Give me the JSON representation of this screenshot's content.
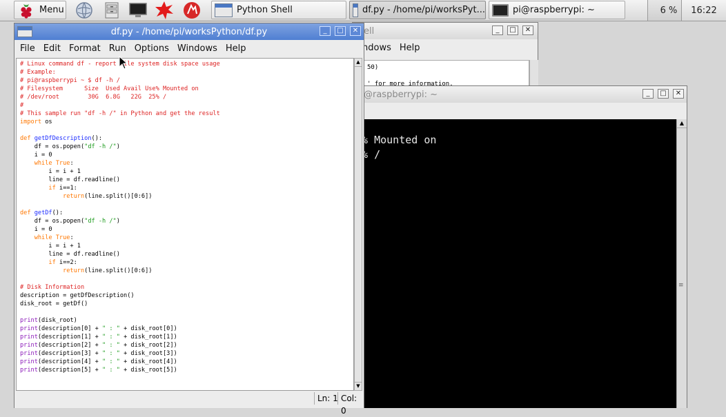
{
  "taskbar": {
    "menu_label": "Menu",
    "items": [
      {
        "label": "Python Shell"
      },
      {
        "label": "df.py - /home/pi/worksPyt..."
      },
      {
        "label": "pi@raspberrypi: ~"
      }
    ],
    "cpu": "6 %",
    "clock": "16:22"
  },
  "shell_window": {
    "title_fragment": "ell",
    "menu": [
      "ndows",
      "Help"
    ],
    "lines": [
      "50)",
      "' for more information."
    ]
  },
  "terminal_window": {
    "title": "@raspberrypi: ~",
    "lines": [
      "e% Mounted on",
      "5% /"
    ]
  },
  "editor_window": {
    "title": "df.py - /home/pi/worksPython/df.py",
    "menu": [
      "File",
      "Edit",
      "Format",
      "Run",
      "Options",
      "Windows",
      "Help"
    ],
    "code": {
      "l1": "# Linux command df - report file system disk space usage",
      "l2": "# Example:",
      "l3": "# pi@raspberrypi ~ $ df -h /",
      "l4": "# Filesystem      Size  Used Avail Use% Mounted on",
      "l5": "# /dev/root        30G  6.8G   22G  25% /",
      "l6": "#",
      "l7": "# This sample run \"df -h /\" in Python and get the result",
      "import_kw": "import",
      "import_rest": " os",
      "def_kw": "def",
      "func1": "getDfDescription",
      "func2": "getDf",
      "paren_colon": "():",
      "df_assign": "    df = os.popen(",
      "df_str": "\"df -h /\"",
      "close_paren": ")",
      "i_zero": "    i = 0",
      "while_kw": "    while",
      "true_kw": " True",
      "colon": ":",
      "i_inc": "        i = i + 1",
      "readline": "        line = df.readline()",
      "if_kw": "        if",
      "if1_rest": " i==1:",
      "if2_rest": " i==2:",
      "return_kw": "            return",
      "return_rest": "(line.split()[0:6])",
      "comment_disk": "# Disk Information",
      "desc_assign": "description = getDfDescription()",
      "root_assign": "disk_root = getDf()",
      "print_kw": "print",
      "print_root": "(disk_root)",
      "sep": "\" : \"",
      "p0a": "(description[0] + ",
      "p0b": " + disk_root[0])",
      "p1a": "(description[1] + ",
      "p1b": " + disk_root[1])",
      "p2a": "(description[2] + ",
      "p2b": " + disk_root[2])",
      "p3a": "(description[3] + ",
      "p3b": " + disk_root[3])",
      "p4a": "(description[4] + ",
      "p4b": " + disk_root[4])",
      "p5a": "(description[5] + ",
      "p5b": " + disk_root[5])"
    },
    "status": {
      "line": "Ln: 1",
      "col": "Col: 0"
    }
  },
  "colors": {
    "title_active": "#4f7fd2",
    "comment": "#dd2222",
    "keyword": "#ff7700",
    "definition": "#1b2bff",
    "string": "#1a9a1a",
    "builtin": "#8a18b8"
  }
}
